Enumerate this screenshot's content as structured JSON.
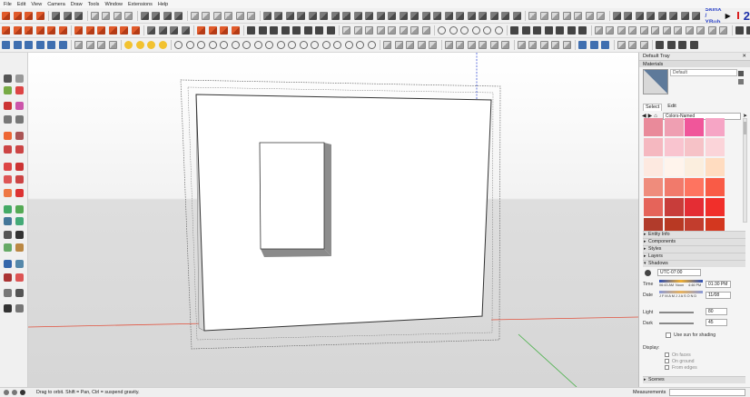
{
  "menu": [
    "File",
    "Edit",
    "View",
    "Camera",
    "Draw",
    "Tools",
    "Window",
    "Extensions",
    "Help"
  ],
  "toolbar": {
    "skinx_label": "SkinX / YBub"
  },
  "icons": {
    "tool_family": [
      "component-icon",
      "paint-icon",
      "eraser-icon",
      "pencil-icon",
      "arc-icon",
      "rectangle-icon",
      "circle-icon",
      "push-pull-icon",
      "move-icon",
      "rotate-icon",
      "scale-icon",
      "offset-icon",
      "tape-icon",
      "text-icon",
      "orbit-icon",
      "pan-icon",
      "zoom-icon",
      "zoom-extents-icon",
      "walk-icon",
      "look-around-icon"
    ]
  },
  "tray": {
    "title": "Default Tray",
    "materials_label": "Materials",
    "material_name": "Default",
    "tab_select": "Select",
    "tab_edit": "Edit",
    "library": "Colors-Named",
    "swatches": [
      "#e98a9a",
      "#ef9fb2",
      "#f0569a",
      "#f6a5c5",
      "#f5b8c0",
      "#f9c4cf",
      "#f6c2c7",
      "#fbd4d9",
      "#fde9e0",
      "#fff4ec",
      "#fbeede",
      "#ffdcc0",
      "#ef8c7c",
      "#f17a6b",
      "#fe7460",
      "#f95b46",
      "#e5645a",
      "#c83d3a",
      "#e42d34",
      "#f12f2a",
      "#b13b2b",
      "#b83923",
      "#c23d2d",
      "#d3371f"
    ],
    "panels_collapsed": [
      "Entity Info",
      "Components",
      "Styles",
      "Layers"
    ],
    "shadows_label": "Shadows",
    "timezone": "UTC-07:00",
    "time_label": "Time",
    "time_start": "06:43 AM",
    "time_noon": "Noon",
    "time_end": "4:46 PM",
    "time_value": "01:30 PM",
    "date_label": "Date",
    "date_months": "J F M A M J J A S O N D",
    "date_value": "11/08",
    "light_label": "Light",
    "light_value": "80",
    "dark_label": "Dark",
    "dark_value": "45",
    "use_sun_label": "Use sun for shading",
    "display_label": "Display:",
    "on_faces": "On faces",
    "on_ground": "On ground",
    "from_edges": "From edges",
    "scenes_label": "Scenes"
  },
  "status": {
    "hint": "Drag to orbit. Shift = Pan, Ctrl = suspend gravity.",
    "measurements_label": "Measurements"
  }
}
